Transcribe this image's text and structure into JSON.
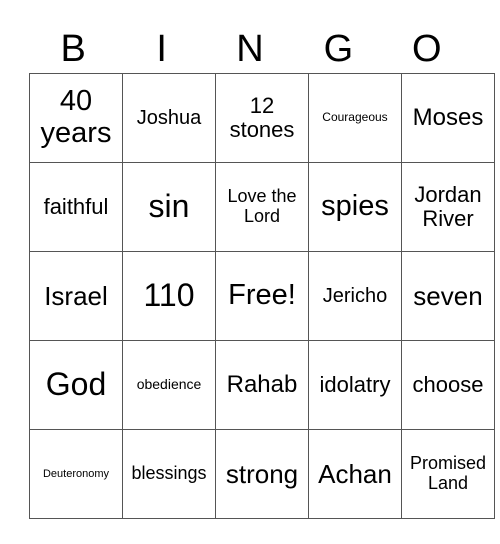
{
  "header": [
    "B",
    "I",
    "N",
    "G",
    "O"
  ],
  "grid": [
    [
      "40 years",
      "Joshua",
      "12 stones",
      "Courageous",
      "Moses"
    ],
    [
      "faithful",
      "sin",
      "Love the Lord",
      "spies",
      "Jordan River"
    ],
    [
      "Israel",
      "110",
      "Free!",
      "Jericho",
      "seven"
    ],
    [
      "God",
      "obedience",
      "Rahab",
      "idolatry",
      "choose"
    ],
    [
      "Deuteronomy",
      "blessings",
      "strong",
      "Achan",
      "Promised Land"
    ]
  ]
}
